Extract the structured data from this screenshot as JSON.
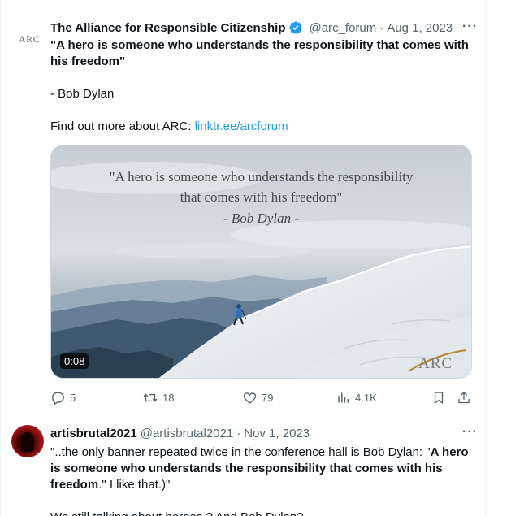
{
  "tweet1": {
    "display_name": "The Alliance for Responsible Citizenship",
    "handle": "@arc_forum",
    "separator": "·",
    "date": "Aug 1, 2023",
    "more": "···",
    "avatar_text": "ARC",
    "text_quote": "\"A hero is someone who understands the responsibility that comes with his freedom\"",
    "text_author": "- Bob Dylan",
    "text_more_prefix": "Find out more about ARC: ",
    "text_link": "linktr.ee/arcforum",
    "media": {
      "quote_line1": "\"A hero is someone who understands the responsibility",
      "quote_line2": "that comes with his freedom\"",
      "quote_author": "- Bob Dylan -",
      "duration": "0:08",
      "watermark": "ARC"
    },
    "actions": {
      "replies": "5",
      "reposts": "18",
      "likes": "79",
      "views": "4.1K"
    }
  },
  "tweet2": {
    "display_name": "artisbrutal2021",
    "handle": "@artisbrutal2021",
    "separator": "·",
    "date": "Nov 1, 2023",
    "more": "···",
    "text_part1": "\"..the only banner repeated twice in the conference hall is Bob Dylan: \"",
    "text_bold": "A hero is someone who understands the responsibility that comes with his freedom",
    "text_part2": ".\" I like that.)\"",
    "text_cut": "We still talking about heroes ? And Bob Dylan?"
  },
  "colors": {
    "accent": "#1d9bf0",
    "secondary_text": "#536471",
    "border": "#eff3f4"
  }
}
